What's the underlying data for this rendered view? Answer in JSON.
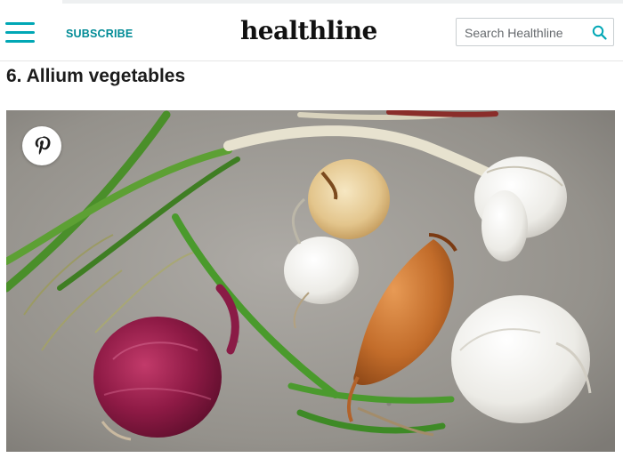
{
  "header": {
    "subscribe_label": "SUBSCRIBE",
    "logo_text": "healthline",
    "search_placeholder": "Search Healthline",
    "icons": {
      "menu": "hamburger-menu-icon",
      "search": "search-icon"
    },
    "colors": {
      "accent": "#00a7b5",
      "subscribe": "#008b96",
      "logo": "#111111"
    }
  },
  "article": {
    "section_title": "6. Allium vegetables",
    "image": {
      "subject": "allium vegetables on grey stone: red onion, shallot, yellow onion, white onions, garlic, green onions",
      "share_icon": "pinterest-icon"
    }
  }
}
